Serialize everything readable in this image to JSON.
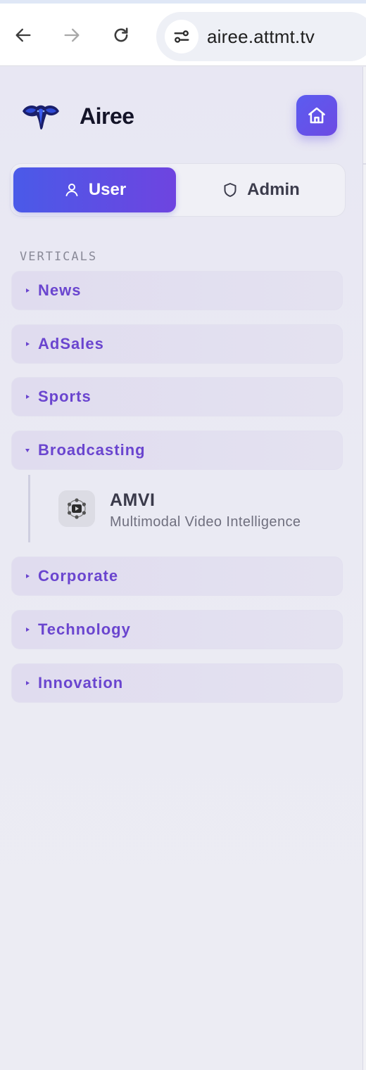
{
  "browser": {
    "url": "airee.attmt.tv",
    "icons": {
      "back": "arrow-left-icon",
      "forward": "arrow-right-icon",
      "reload": "reload-icon",
      "site_info": "tune-icon"
    }
  },
  "brand": {
    "name": "Airee",
    "logo": "elephant-logo",
    "home_icon": "home-icon"
  },
  "role_toggle": {
    "user_label": "User",
    "admin_label": "Admin",
    "selected": "User",
    "user_icon": "person-icon",
    "admin_icon": "shield-icon"
  },
  "sidebar": {
    "section_label": "VERTICALS",
    "verticals": [
      {
        "label": "News",
        "expanded": false
      },
      {
        "label": "AdSales",
        "expanded": false
      },
      {
        "label": "Sports",
        "expanded": false
      },
      {
        "label": "Broadcasting",
        "expanded": true,
        "apps": [
          {
            "title": "AMVI",
            "subtitle": "Multimodal Video Intelligence",
            "icon": "amvi-app-icon"
          }
        ]
      },
      {
        "label": "Corporate",
        "expanded": false
      },
      {
        "label": "Technology",
        "expanded": false
      },
      {
        "label": "Innovation",
        "expanded": false
      }
    ]
  },
  "colors": {
    "accent": "#6a45cf",
    "primary_gradient_start": "#4a5ae8",
    "primary_gradient_end": "#6e44e0"
  }
}
